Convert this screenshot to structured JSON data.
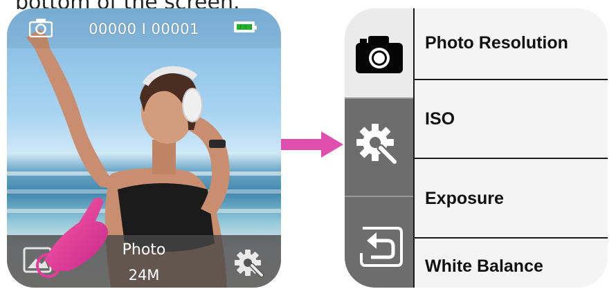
{
  "caption": "bottom of the screen.",
  "camera_screen": {
    "counter": "00000  I  00001",
    "mode_label": "Photo",
    "resolution": "24M",
    "icons": [
      "camera-icon",
      "battery-icon",
      "gallery-icon",
      "settings-gear-icon",
      "pointing-hand-icon"
    ],
    "battery_level": 1.0
  },
  "menu_panel": {
    "sidebar": [
      "camera-icon",
      "settings-gear-icon",
      "back-return-icon"
    ],
    "items": [
      {
        "label": "Photo Resolution"
      },
      {
        "label": "ISO"
      },
      {
        "label": "Exposure"
      },
      {
        "label": "White Balance"
      }
    ]
  },
  "colors": {
    "arrow": "#e04fae",
    "hand": "#e33d9b",
    "battery": "#23b02b",
    "sidebar_dark": "#6d6d6d"
  }
}
